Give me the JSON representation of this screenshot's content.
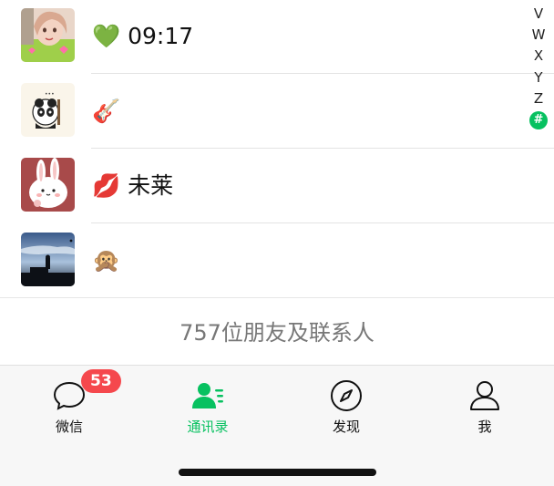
{
  "contacts": [
    {
      "emoji": "💚",
      "text": "09:17"
    },
    {
      "emoji": "🎸",
      "text": ""
    },
    {
      "emoji": "💋",
      "text": "未莱"
    },
    {
      "emoji": "🙊",
      "text": ""
    }
  ],
  "index_bar": {
    "letters": [
      "V",
      "W",
      "X",
      "Y",
      "Z"
    ],
    "active": "#",
    "active_color": "#07c160"
  },
  "footer": {
    "count_text": "757位朋友及联系人"
  },
  "tab_bar": {
    "tabs": [
      {
        "label": "微信",
        "icon": "chat-bubble-icon",
        "badge": "53"
      },
      {
        "label": "通讯录",
        "icon": "contacts-icon"
      },
      {
        "label": "发现",
        "icon": "compass-icon"
      },
      {
        "label": "我",
        "icon": "person-icon"
      }
    ],
    "active_color": "#07c160",
    "badge_color": "#f5484d"
  }
}
